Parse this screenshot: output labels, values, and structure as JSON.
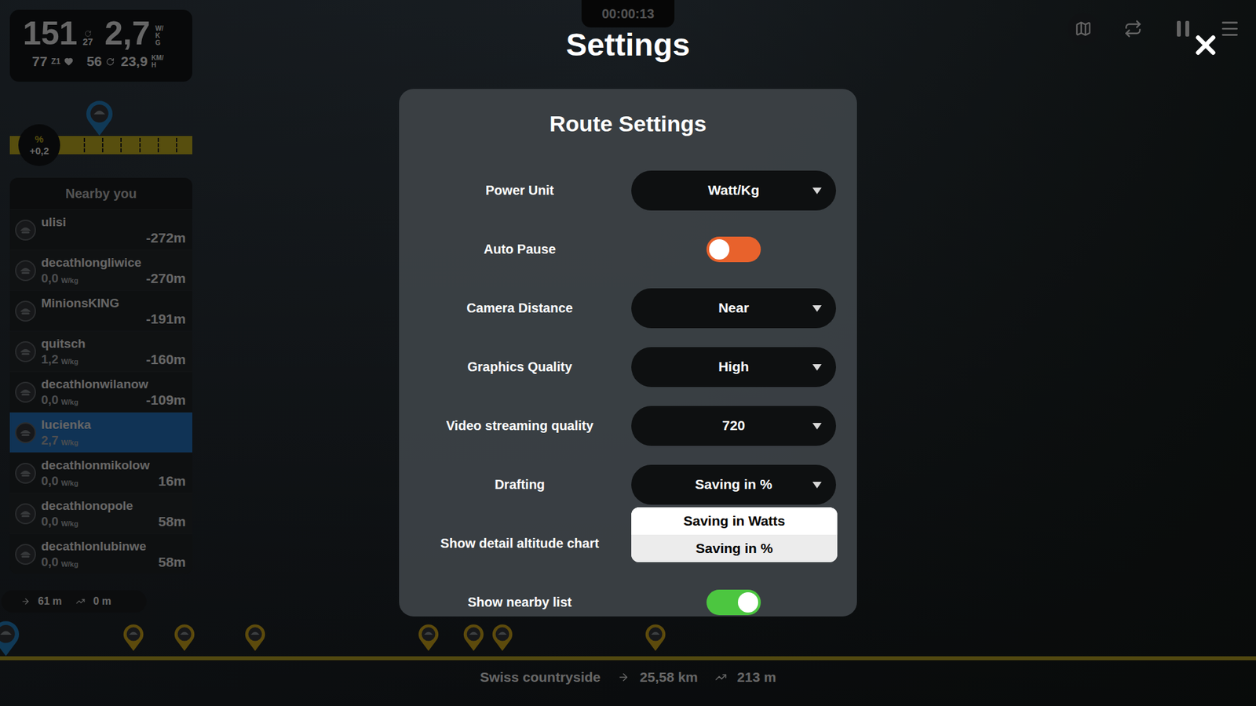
{
  "timer": "00:00:13",
  "stats": {
    "power": "151",
    "power_avg": "27",
    "wkg": "2,7",
    "wkg_unit": "W/KG",
    "heart_rate": "77",
    "zone": "Z1",
    "cadence": "56",
    "speed": "23,9",
    "speed_unit": "KM/H"
  },
  "gradient": {
    "label": "%",
    "value": "+0,2"
  },
  "nearby": {
    "title": "Nearby you",
    "riders": [
      {
        "name": "ulisi",
        "power": "",
        "unit": "",
        "distance": "-272m",
        "selected": false
      },
      {
        "name": "decathlongliwice",
        "power": "0,0",
        "unit": "W/kg",
        "distance": "-270m",
        "selected": false
      },
      {
        "name": "MinionsKING",
        "power": "",
        "unit": "",
        "distance": "-191m",
        "selected": false
      },
      {
        "name": "quitsch",
        "power": "1,2",
        "unit": "W/kg",
        "distance": "-160m",
        "selected": false
      },
      {
        "name": "decathlonwilanow",
        "power": "0,0",
        "unit": "W/kg",
        "distance": "-109m",
        "selected": false
      },
      {
        "name": "lucienka",
        "power": "2,7",
        "unit": "W/kg",
        "distance": "",
        "selected": true
      },
      {
        "name": "decathlonmikolow",
        "power": "0,0",
        "unit": "W/kg",
        "distance": "16m",
        "selected": false
      },
      {
        "name": "decathlonopole",
        "power": "0,0",
        "unit": "W/kg",
        "distance": "58m",
        "selected": false
      },
      {
        "name": "decathlonlubinwe",
        "power": "0,0",
        "unit": "W/kg",
        "distance": "58m",
        "selected": false
      }
    ],
    "footer": {
      "distance": "61 m",
      "elevation": "0 m"
    }
  },
  "route": {
    "name": "Swiss countryside",
    "distance": "25,58 km",
    "elevation": "213 m",
    "markers": [
      {
        "level": 0.106
      },
      {
        "level": 0.147
      },
      {
        "level": 0.203
      },
      {
        "level": 0.341
      },
      {
        "level": 0.377
      },
      {
        "level": 0.4
      },
      {
        "level": 0.522
      }
    ]
  },
  "settings": {
    "title": "Settings",
    "panel": {
      "title": "Route Settings",
      "rows": [
        {
          "label": "Power Unit",
          "kind": "select",
          "value": "Watt/Kg",
          "expanded": false
        },
        {
          "label": "Auto Pause",
          "kind": "toggle",
          "on": false
        },
        {
          "label": "Camera Distance",
          "kind": "select",
          "value": "Near",
          "expanded": false
        },
        {
          "label": "Graphics Quality",
          "kind": "select",
          "value": "High",
          "expanded": false
        },
        {
          "label": "Video streaming quality",
          "kind": "select",
          "value": "720",
          "expanded": false
        },
        {
          "label": "Drafting",
          "kind": "select",
          "value": "Saving in %",
          "expanded": true,
          "options": [
            {
              "label": "Saving in Watts",
              "selected": false
            },
            {
              "label": "Saving in %",
              "selected": true
            }
          ]
        },
        {
          "label": "Show detail altitude chart",
          "kind": "covered"
        },
        {
          "label": "Show nearby list",
          "kind": "toggle",
          "on": true
        }
      ]
    }
  }
}
